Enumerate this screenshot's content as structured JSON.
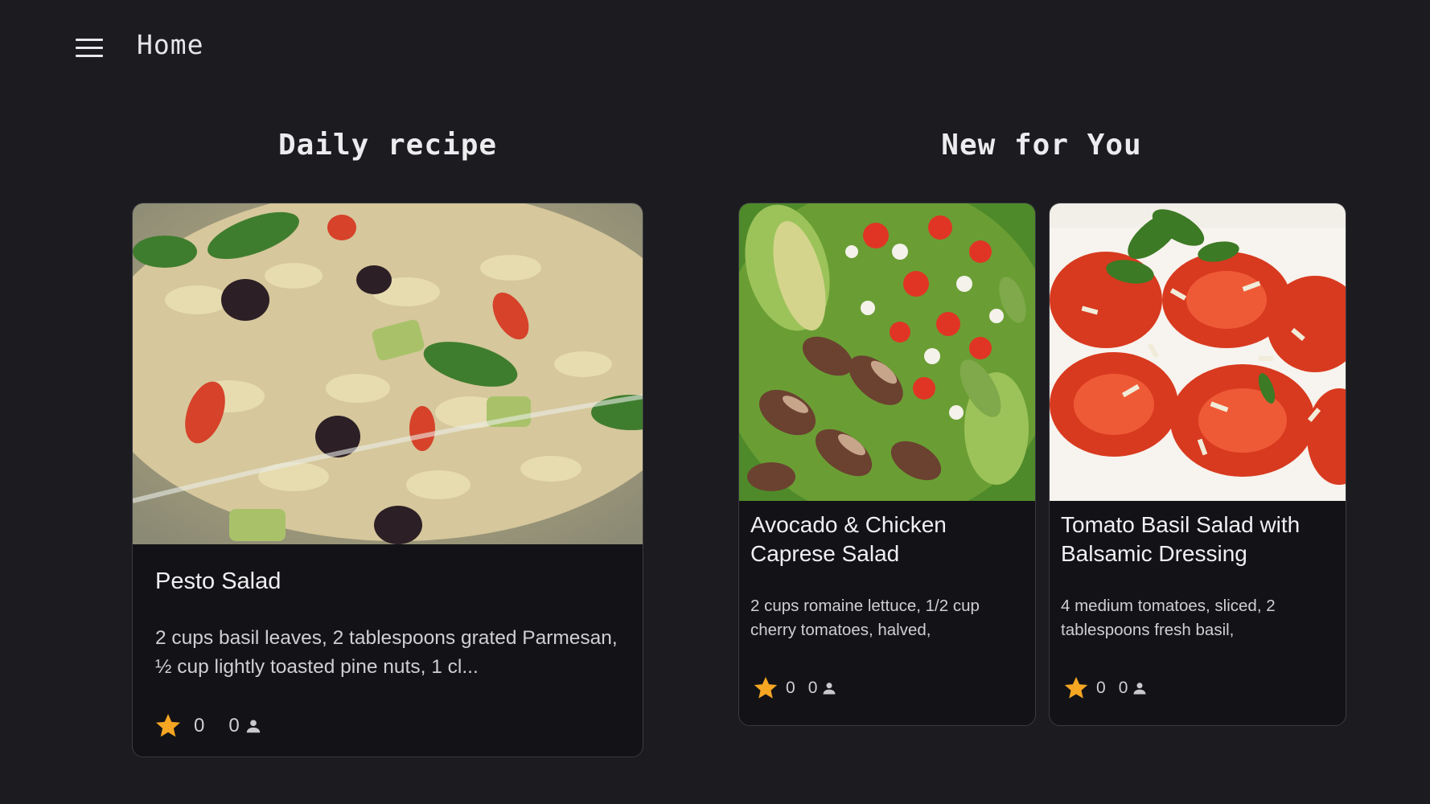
{
  "header": {
    "title": "Home",
    "menu_icon": "hamburger-menu-icon"
  },
  "daily": {
    "heading": "Daily recipe",
    "card": {
      "title": "Pesto Salad",
      "description": "2 cups basil leaves, 2 tablespoons grated Parmesan, ½ cup lightly toasted pine nuts, 1 cl...",
      "rating": "0",
      "users": "0",
      "image": "pasta-salad-photo"
    }
  },
  "new_for_you": {
    "heading": "New for You",
    "cards": [
      {
        "title": "Avocado & Chicken Caprese Salad",
        "description": "2 cups romaine lettuce, 1/2 cup cherry tomatoes, halved,",
        "rating": "0",
        "users": "0",
        "image": "chicken-caprese-salad-photo"
      },
      {
        "title": "Tomato Basil Salad with Balsamic Dressing",
        "description": "4 medium tomatoes, sliced, 2 tablespoons fresh basil,",
        "rating": "0",
        "users": "0",
        "image": "tomato-basil-salad-photo"
      }
    ]
  },
  "colors": {
    "background": "#1b1b20",
    "card": "#131317",
    "star": "#f5a623",
    "text": "#e8e8ea"
  }
}
